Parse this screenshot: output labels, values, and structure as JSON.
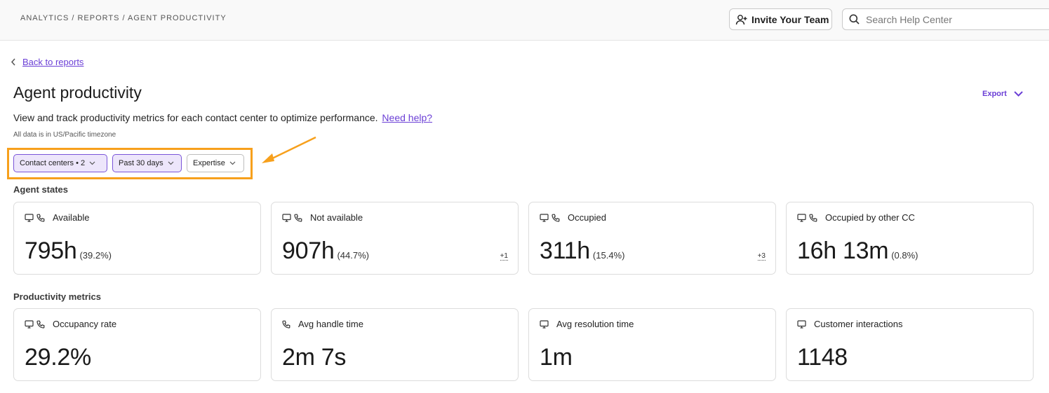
{
  "header": {
    "breadcrumb": "ANALYTICS / REPORTS / AGENT PRODUCTIVITY",
    "invite_label": "Invite Your Team",
    "search_placeholder": "Search Help Center"
  },
  "nav": {
    "back_label": "Back to reports"
  },
  "page": {
    "title": "Agent productivity",
    "export_label": "Export",
    "subtitle": "View and track productivity metrics for each contact center to optimize performance.",
    "help_link": "Need help?",
    "timezone_note": "All data is in US/Pacific timezone"
  },
  "filters": [
    {
      "label": "Contact centers • 2",
      "active": true
    },
    {
      "label": "Past 30 days",
      "active": true
    },
    {
      "label": "Expertise",
      "active": false
    }
  ],
  "sections": {
    "agent_states": "Agent states",
    "productivity": "Productivity metrics"
  },
  "agent_states": [
    {
      "label": "Available",
      "value": "795h",
      "pct": "(39.2%)",
      "extra": "",
      "icons": [
        "monitor-icon",
        "phone-icon"
      ]
    },
    {
      "label": "Not available",
      "value": "907h",
      "pct": "(44.7%)",
      "extra": "+1",
      "icons": [
        "monitor-icon",
        "phone-icon"
      ]
    },
    {
      "label": "Occupied",
      "value": "311h",
      "pct": "(15.4%)",
      "extra": "+3",
      "icons": [
        "monitor-icon",
        "phone-icon"
      ]
    },
    {
      "label": "Occupied by other CC",
      "value": "16h 13m",
      "pct": "(0.8%)",
      "extra": "",
      "icons": [
        "monitor-icon",
        "phone-icon"
      ]
    }
  ],
  "productivity_metrics": [
    {
      "label": "Occupancy rate",
      "value": "29.2%",
      "icons": [
        "monitor-icon",
        "phone-icon"
      ]
    },
    {
      "label": "Avg handle time",
      "value": "2m 7s",
      "icons": [
        "phone-icon"
      ]
    },
    {
      "label": "Avg resolution time",
      "value": "1m",
      "icons": [
        "monitor-icon"
      ]
    },
    {
      "label": "Customer interactions",
      "value": "1148",
      "icons": [
        "monitor-icon"
      ]
    }
  ],
  "colors": {
    "accent": "#6b3fd6",
    "highlight": "#f7a01c",
    "chip_bg": "#ede6fb"
  }
}
